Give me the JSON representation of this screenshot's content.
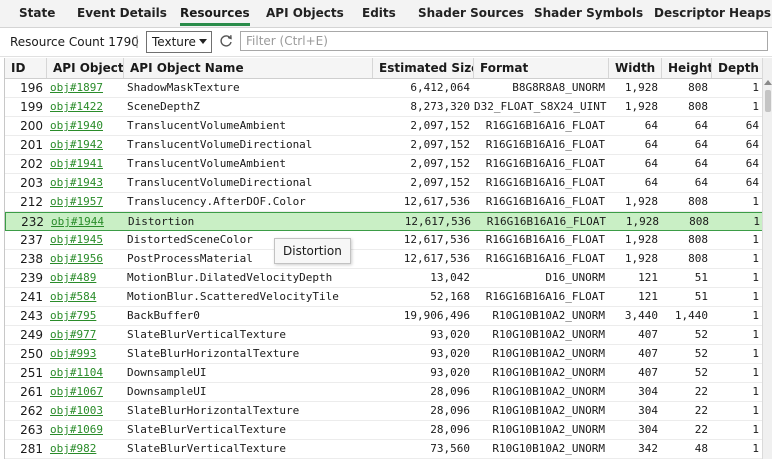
{
  "tabs": [
    "State",
    "Event Details",
    "Resources",
    "API Objects",
    "Edits",
    "Shader Sources",
    "Shader Symbols",
    "Descriptor Heaps"
  ],
  "active_tab": "Resources",
  "toolbar": {
    "resource_count": "Resource Count 1790",
    "separator": "|",
    "type_filter": "Texture",
    "filter_placeholder": "Filter (Ctrl+E)"
  },
  "columns": [
    "ID",
    "API Object",
    "API Object Name",
    "Estimated Size*",
    "Format",
    "Width",
    "Height",
    "Depth"
  ],
  "rows": [
    [
      "196",
      "obj#1897",
      "ShadowMaskTexture",
      "6,412,064",
      "B8G8R8A8_UNORM",
      "1,928",
      "808",
      "1"
    ],
    [
      "199",
      "obj#1422",
      "SceneDepthZ",
      "8,273,320",
      "D32_FLOAT_S8X24_UINT",
      "1,928",
      "808",
      "1"
    ],
    [
      "200",
      "obj#1940",
      "TranslucentVolumeAmbient",
      "2,097,152",
      "R16G16B16A16_FLOAT",
      "64",
      "64",
      "64"
    ],
    [
      "201",
      "obj#1942",
      "TranslucentVolumeDirectional",
      "2,097,152",
      "R16G16B16A16_FLOAT",
      "64",
      "64",
      "64"
    ],
    [
      "202",
      "obj#1941",
      "TranslucentVolumeAmbient",
      "2,097,152",
      "R16G16B16A16_FLOAT",
      "64",
      "64",
      "64"
    ],
    [
      "203",
      "obj#1943",
      "TranslucentVolumeDirectional",
      "2,097,152",
      "R16G16B16A16_FLOAT",
      "64",
      "64",
      "64"
    ],
    [
      "212",
      "obj#1957",
      "Translucency.AfterDOF.Color",
      "12,617,536",
      "R16G16B16A16_FLOAT",
      "1,928",
      "808",
      "1"
    ],
    [
      "232",
      "obj#1944",
      "Distortion",
      "12,617,536",
      "R16G16B16A16_FLOAT",
      "1,928",
      "808",
      "1"
    ],
    [
      "237",
      "obj#1945",
      "DistortedSceneColor",
      "12,617,536",
      "R16G16B16A16_FLOAT",
      "1,928",
      "808",
      "1"
    ],
    [
      "238",
      "obj#1956",
      "PostProcessMaterial",
      "12,617,536",
      "R16G16B16A16_FLOAT",
      "1,928",
      "808",
      "1"
    ],
    [
      "239",
      "obj#489",
      "MotionBlur.DilatedVelocityDepth",
      "13,042",
      "D16_UNORM",
      "121",
      "51",
      "1"
    ],
    [
      "241",
      "obj#584",
      "MotionBlur.ScatteredVelocityTile",
      "52,168",
      "R16G16B16A16_FLOAT",
      "121",
      "51",
      "1"
    ],
    [
      "243",
      "obj#795",
      "BackBuffer0",
      "19,906,496",
      "R10G10B10A2_UNORM",
      "3,440",
      "1,440",
      "1"
    ],
    [
      "249",
      "obj#977",
      "SlateBlurVerticalTexture",
      "93,020",
      "R10G10B10A2_UNORM",
      "407",
      "52",
      "1"
    ],
    [
      "250",
      "obj#993",
      "SlateBlurHorizontalTexture",
      "93,020",
      "R10G10B10A2_UNORM",
      "407",
      "52",
      "1"
    ],
    [
      "251",
      "obj#1104",
      "DownsampleUI",
      "93,020",
      "R10G10B10A2_UNORM",
      "407",
      "52",
      "1"
    ],
    [
      "261",
      "obj#1067",
      "DownsampleUI",
      "28,096",
      "R10G10B10A2_UNORM",
      "304",
      "22",
      "1"
    ],
    [
      "262",
      "obj#1003",
      "SlateBlurHorizontalTexture",
      "28,096",
      "R10G10B10A2_UNORM",
      "304",
      "22",
      "1"
    ],
    [
      "263",
      "obj#1069",
      "SlateBlurVerticalTexture",
      "28,096",
      "R10G10B10A2_UNORM",
      "304",
      "22",
      "1"
    ],
    [
      "281",
      "obj#982",
      "SlateBlurVerticalTexture",
      "73,560",
      "R10G10B10A2_UNORM",
      "342",
      "48",
      "1"
    ]
  ],
  "selected_row_id": "232",
  "tooltip": "Distortion",
  "colors": {
    "accent": "#2a8c4a",
    "link": "#2a8c2a",
    "selected_bg": "#c9efc5",
    "selected_border": "#3b9c46"
  }
}
